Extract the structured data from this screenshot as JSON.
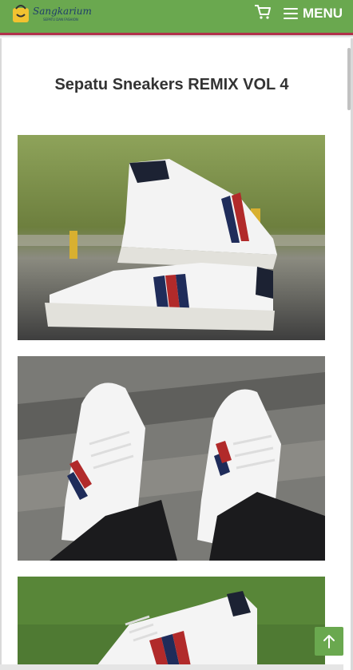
{
  "header": {
    "brand_name": "Sangkarium",
    "brand_tagline": "SEPATU DAN FASHION",
    "menu_label": "MENU",
    "colors": {
      "bar": "#6aa84f",
      "accent_border": "#b0314a"
    }
  },
  "page": {
    "title": "Sepatu Sneakers REMIX VOL 4"
  },
  "images": [
    {
      "name": "product-photo-1"
    },
    {
      "name": "product-photo-2"
    },
    {
      "name": "product-photo-3"
    }
  ],
  "icons": {
    "cart": "cart-icon",
    "menu": "hamburger-icon",
    "back_to_top": "arrow-up-icon"
  }
}
